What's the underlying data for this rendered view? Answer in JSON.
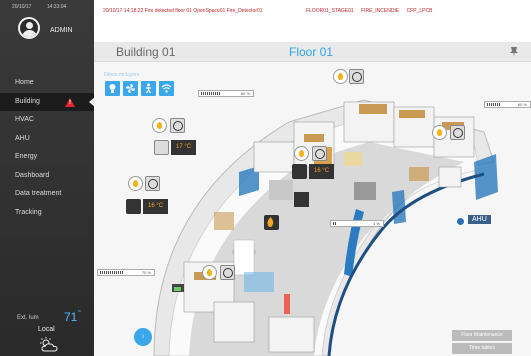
{
  "sidebar": {
    "date": "20/10/17",
    "time": "14:33:04",
    "user": "ADMIN",
    "nav": [
      {
        "label": "Home",
        "active": false
      },
      {
        "label": "Building",
        "active": true,
        "alert": true
      },
      {
        "label": "HVAC",
        "active": false
      },
      {
        "label": "AHU",
        "active": false
      },
      {
        "label": "Energy",
        "active": false
      },
      {
        "label": "Dashboard",
        "active": false
      },
      {
        "label": "Data treatment",
        "active": false
      },
      {
        "label": "Tracking",
        "active": false
      }
    ],
    "ext_label": "Ext. lum",
    "ext_value": "71",
    "ext_unit": "lx",
    "location": "Local",
    "weather_icon": "partly-cloudy-icon"
  },
  "alert": {
    "message": "20/10/17  14:18:22  Fire detected floor 01 OpenSpace01 Fire_Detector01",
    "codes": [
      "FLOOR01_STAGE01",
      "FIRE_INCENDIE",
      "CFP_LPCB"
    ],
    "color": "#c0262c"
  },
  "header": {
    "building": "Building 01",
    "floor": "Floor 01",
    "floor_color": "#2ca7e8"
  },
  "map": {
    "filters_label": "Filters on layers",
    "filters": [
      "lighting-icon",
      "ventilation-icon",
      "occupancy-icon",
      "wifi-icon"
    ],
    "bars": [
      {
        "pct": "60 %"
      },
      {
        "pct": "60 %"
      },
      {
        "pct": "60 %"
      },
      {
        "pct": "70 %"
      },
      {
        "pct": "1 %"
      }
    ],
    "temps": [
      "17 °C",
      "16 °C",
      "16 °C"
    ],
    "ahu_label": "AHU",
    "help_label": "i\nN"
  },
  "buttons": {
    "floor_maintenance": "Floor Maintenance",
    "time_tables": "Time tables"
  }
}
